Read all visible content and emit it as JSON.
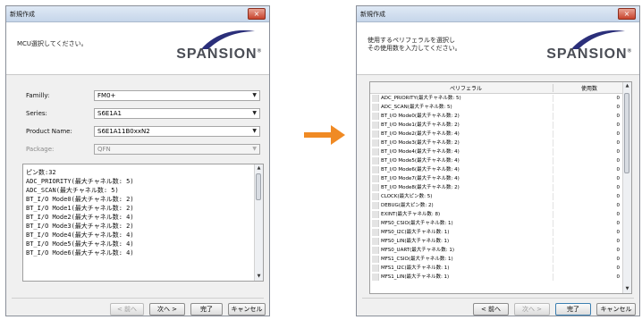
{
  "left_window": {
    "title": "新規作成",
    "close_glyph": "×",
    "message": "MCU選択してください。",
    "logo_text": "SPANSION",
    "logo_mark": "®",
    "fields": [
      {
        "label": "Familly:",
        "value": "FM0+",
        "disabled": false
      },
      {
        "label": "Series:",
        "value": "S6E1A1",
        "disabled": false
      },
      {
        "label": "Product Name:",
        "value": "S6E1A11B0xxN2",
        "disabled": false
      },
      {
        "label": "Package:",
        "value": "QFN",
        "disabled": true
      }
    ],
    "details": [
      "ピン数:32",
      "ADC_PRIORITY(最大チャネル数: 5)",
      "ADC_SCAN(最大チャネル数: 5)",
      "BT_I/O Mode0(最大チャネル数: 2)",
      "BT_I/O Mode1(最大チャネル数: 2)",
      "BT_I/O Mode2(最大チャネル数: 4)",
      "BT_I/O Mode3(最大チャネル数: 2)",
      "BT_I/O Mode4(最大チャネル数: 4)",
      "BT_I/O Mode5(最大チャネル数: 4)",
      "BT_I/O Mode6(最大チャネル数: 4)"
    ],
    "details_scroll_fraction": 0.0,
    "buttons": {
      "back": "< 前へ",
      "next": "次へ >",
      "finish": "完了",
      "cancel": "キャンセル"
    }
  },
  "right_window": {
    "title": "新規作成",
    "close_glyph": "×",
    "message_line1": "使用するペリフェラルを選択し",
    "message_line2": "その使用数を入力してください。",
    "logo_text": "SPANSION",
    "logo_mark": "®",
    "columns": {
      "peripheral": "ペリフェラル",
      "count": "使用数"
    },
    "rows": [
      {
        "name": "ADC_PRIORITY(最大チャネル数: 5)",
        "count": "0"
      },
      {
        "name": "ADC_SCAN(最大チャネル数: 5)",
        "count": "0"
      },
      {
        "name": "BT_I/O Mode0(最大チャネル数: 2)",
        "count": "0"
      },
      {
        "name": "BT_I/O Mode1(最大チャネル数: 2)",
        "count": "0"
      },
      {
        "name": "BT_I/O Mode2(最大チャネル数: 4)",
        "count": "0"
      },
      {
        "name": "BT_I/O Mode3(最大チャネル数: 2)",
        "count": "0"
      },
      {
        "name": "BT_I/O Mode4(最大チャネル数: 4)",
        "count": "0"
      },
      {
        "name": "BT_I/O Mode5(最大チャネル数: 4)",
        "count": "0"
      },
      {
        "name": "BT_I/O Mode6(最大チャネル数: 4)",
        "count": "0"
      },
      {
        "name": "BT_I/O Mode7(最大チャネル数: 4)",
        "count": "0"
      },
      {
        "name": "BT_I/O Mode8(最大チャネル数: 2)",
        "count": "0"
      },
      {
        "name": "CLOCK(最大ピン数: 5)",
        "count": "0"
      },
      {
        "name": "DEBUG(最大ピン数: 2)",
        "count": "0"
      },
      {
        "name": "EXINT(最大チャネル数: 8)",
        "count": "0"
      },
      {
        "name": "MFS0_CSIO(最大チャネル数: 1)",
        "count": "0"
      },
      {
        "name": "MFS0_I2C(最大チャネル数: 1)",
        "count": "0"
      },
      {
        "name": "MFS0_LIN(最大チャネル数: 1)",
        "count": "0"
      },
      {
        "name": "MFS0_UART(最大チャネル数: 1)",
        "count": "0"
      },
      {
        "name": "MFS1_CSIO(最大チャネル数: 1)",
        "count": "0"
      },
      {
        "name": "MFS1_I2C(最大チャネル数: 1)",
        "count": "0"
      },
      {
        "name": "MFS1_LIN(最大チャネル数: 1)",
        "count": "0"
      }
    ],
    "buttons": {
      "back": "< 前へ",
      "next": "次へ >",
      "finish": "完了",
      "cancel": "キャンセル"
    }
  },
  "colors": {
    "arrow": "#f08a24",
    "logo_arc": "#2b2f7a",
    "logo_text": "#4a4d55"
  }
}
